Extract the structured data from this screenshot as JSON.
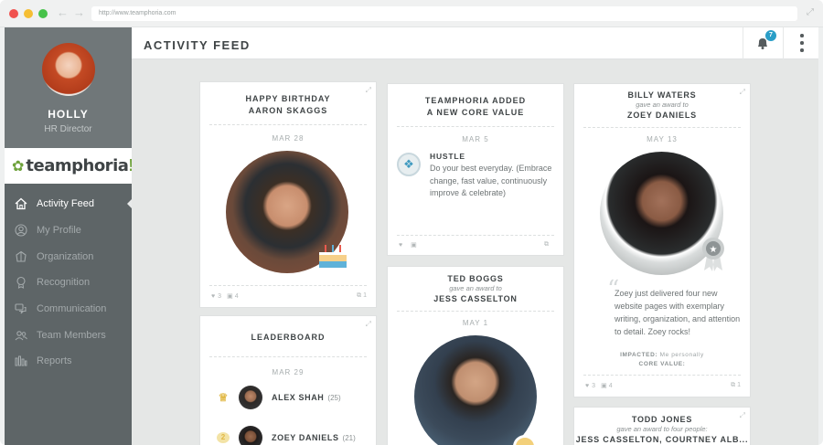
{
  "browser": {
    "url": "http://www.teamphoria.com"
  },
  "user": {
    "name": "HOLLY",
    "role": "HR Director"
  },
  "brand": {
    "logo_text": "teamphoria",
    "logo_suffix": "!"
  },
  "nav": [
    {
      "label": "Activity Feed",
      "icon": "home-icon",
      "active": true
    },
    {
      "label": "My Profile",
      "icon": "user-circle-icon"
    },
    {
      "label": "Organization",
      "icon": "org-icon"
    },
    {
      "label": "Recognition",
      "icon": "award-icon"
    },
    {
      "label": "Communication",
      "icon": "chat-icon"
    },
    {
      "label": "Team Members",
      "icon": "team-icon"
    },
    {
      "label": "Reports",
      "icon": "bar-chart-icon"
    }
  ],
  "header": {
    "title": "ACTIVITY FEED",
    "notifications": "7"
  },
  "feed": {
    "birthday": {
      "title_line1": "HAPPY BIRTHDAY",
      "title_line2": "AARON SKAGGS",
      "date": "MAR 28",
      "likes": "3",
      "comments": "4",
      "shares": "1"
    },
    "core_value": {
      "title_line1": "TEAMPHORIA ADDED",
      "title_line2": "A NEW CORE VALUE",
      "date": "MAR 5",
      "value_name": "HUSTLE",
      "value_text": "Do your best everyday. (Embrace change, fast value, continuously improve & celebrate)"
    },
    "award_zoey": {
      "giver": "BILLY WATERS",
      "sub": "gave an award to",
      "recipient": "ZOEY DANIELS",
      "date": "MAY 13",
      "quote": "Zoey just delivered four new website pages with exemplary writing, organization, and attention to detail. Zoey rocks!",
      "impacted_label": "IMPACTED:",
      "impacted_value": "Me personally",
      "core_value_label": "CORE VALUE:",
      "likes": "3",
      "comments": "4",
      "shares": "1"
    },
    "leaderboard": {
      "title": "LEADERBOARD",
      "date": "MAR 29",
      "rows": [
        {
          "rank": "1",
          "name": "ALEX SHAH",
          "count": "(25)"
        },
        {
          "rank": "2",
          "name": "ZOEY DANIELS",
          "count": "(21)"
        }
      ]
    },
    "award_jess": {
      "giver": "TED BOGGS",
      "sub": "gave an award to",
      "recipient": "JESS CASSELTON",
      "date": "MAY 1"
    },
    "award_todd": {
      "giver": "TODD JONES",
      "sub": "gave an award to four people:",
      "recipient": "JESS CASSELTON, COURTNEY ALB..."
    }
  }
}
